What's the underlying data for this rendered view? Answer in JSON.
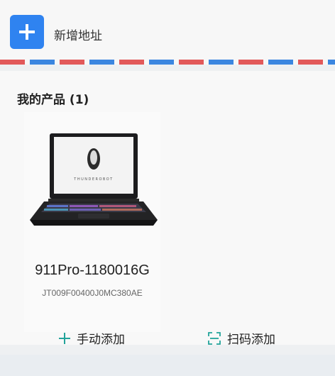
{
  "header": {
    "add_address_label": "新增地址"
  },
  "products_section": {
    "title": "我的产品 (1)",
    "items": [
      {
        "brand_logo_text": "THUNDEROBOT",
        "name": "911Pro-1180016G",
        "serial": "JT009F00400J0MC380AE"
      }
    ]
  },
  "actions": {
    "manual_add_label": "手动添加",
    "scan_add_label": "扫码添加"
  },
  "colors": {
    "accent": "#2f83f0",
    "stripe_red": "#e2595a",
    "stripe_blue": "#3b86e0",
    "action_icon": "#22a39a"
  },
  "icons": {
    "add": "plus-icon",
    "manual_add": "plus-icon",
    "scan_add": "scan-frame-icon"
  }
}
